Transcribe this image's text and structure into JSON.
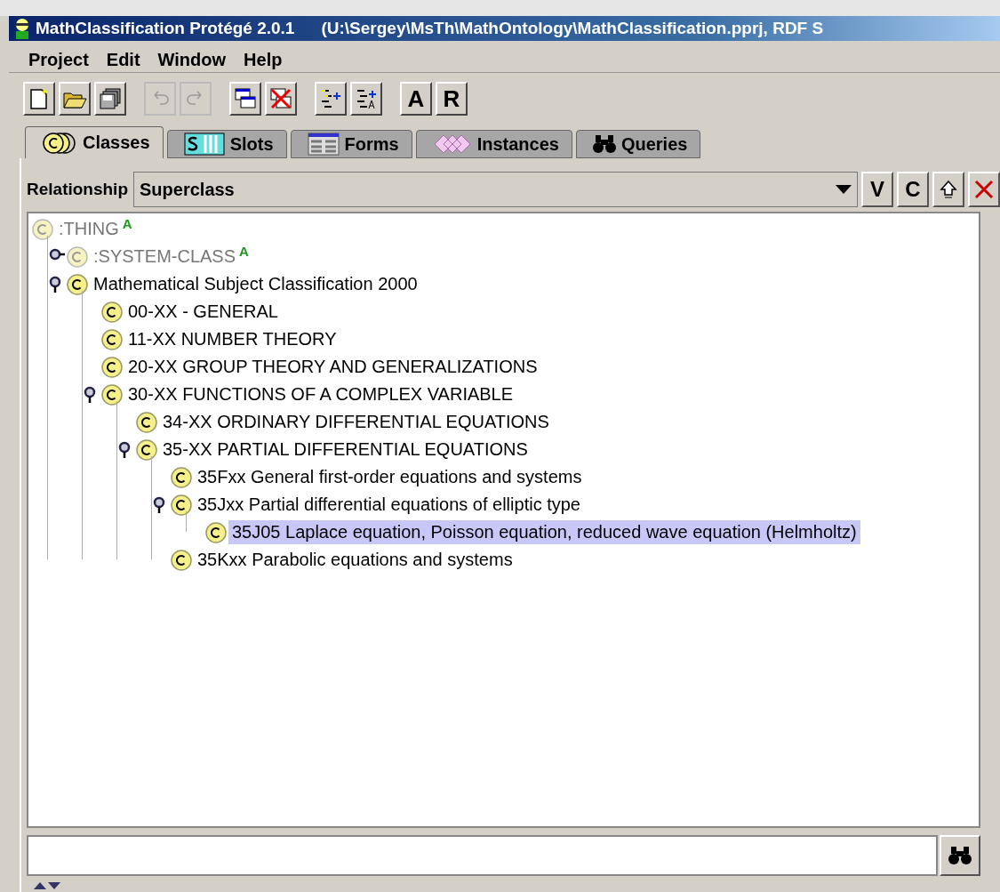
{
  "window": {
    "title": "MathClassification  Protégé 2.0.1",
    "subtitle": "(U:\\Sergey\\MsTh\\MathOntology\\MathClassification.pprj, RDF S"
  },
  "menu": [
    "Project",
    "Edit",
    "Window",
    "Help"
  ],
  "toolbar": [
    [
      {
        "kind": "icon",
        "disabled": false
      },
      {
        "kind": "icon",
        "disabled": false
      },
      {
        "kind": "icon",
        "disabled": false
      }
    ],
    [
      {
        "kind": "icon",
        "disabled": true
      },
      {
        "kind": "icon",
        "disabled": true
      }
    ],
    [
      {
        "kind": "icon",
        "disabled": false
      },
      {
        "kind": "icon",
        "disabled": false
      }
    ],
    [
      {
        "kind": "icon",
        "disabled": false
      },
      {
        "kind": "icon",
        "disabled": false
      }
    ],
    [
      {
        "kind": "text",
        "label": "A",
        "disabled": false
      },
      {
        "kind": "text",
        "label": "R",
        "disabled": false
      }
    ]
  ],
  "tabs": [
    {
      "label": "Classes",
      "selected": true
    },
    {
      "label": "Slots",
      "selected": false
    },
    {
      "label": "Forms",
      "selected": false
    },
    {
      "label": "Instances",
      "selected": false
    },
    {
      "label": "Queries",
      "selected": false
    }
  ],
  "relationship": {
    "label": "Relationship",
    "value": "Superclass",
    "buttons": [
      {
        "kind": "text",
        "label": "V"
      },
      {
        "kind": "text",
        "label": "C"
      },
      {
        "kind": "icon"
      },
      {
        "kind": "icon"
      }
    ]
  },
  "tree": [
    {
      "label": ":THING",
      "system": true,
      "marker": "A",
      "selected": false,
      "children": [
        {
          "label": ":SYSTEM-CLASS",
          "system": true,
          "marker": "A",
          "expanded": false,
          "selected": false
        },
        {
          "label": "Mathematical Subject Classification 2000",
          "system": false,
          "expanded": true,
          "selected": false,
          "children": [
            {
              "label": "00-XX - GENERAL",
              "system": false,
              "selected": false
            },
            {
              "label": "11-XX NUMBER THEORY",
              "system": false,
              "selected": false
            },
            {
              "label": "20-XX GROUP THEORY AND GENERALIZATIONS",
              "system": false,
              "selected": false
            },
            {
              "label": "30-XX FUNCTIONS OF A COMPLEX VARIABLE",
              "system": false,
              "expanded": true,
              "selected": false,
              "children": [
                {
                  "label": "34-XX ORDINARY DIFFERENTIAL EQUATIONS",
                  "system": false,
                  "selected": false
                },
                {
                  "label": "35-XX PARTIAL DIFFERENTIAL EQUATIONS",
                  "system": false,
                  "expanded": true,
                  "selected": false,
                  "children": [
                    {
                      "label": "35Fxx General first-order equations and systems",
                      "system": false,
                      "selected": false
                    },
                    {
                      "label": "35Jxx Partial differential equations of elliptic type",
                      "system": false,
                      "expanded": true,
                      "selected": false,
                      "children": [
                        {
                          "label": "35J05 Laplace equation, Poisson equation, reduced wave equation (Helmholtz)",
                          "system": false,
                          "selected": true
                        }
                      ]
                    },
                    {
                      "label": "35Kxx Parabolic equations and systems",
                      "system": false,
                      "selected": false
                    }
                  ]
                }
              ]
            }
          ]
        }
      ]
    }
  ]
}
